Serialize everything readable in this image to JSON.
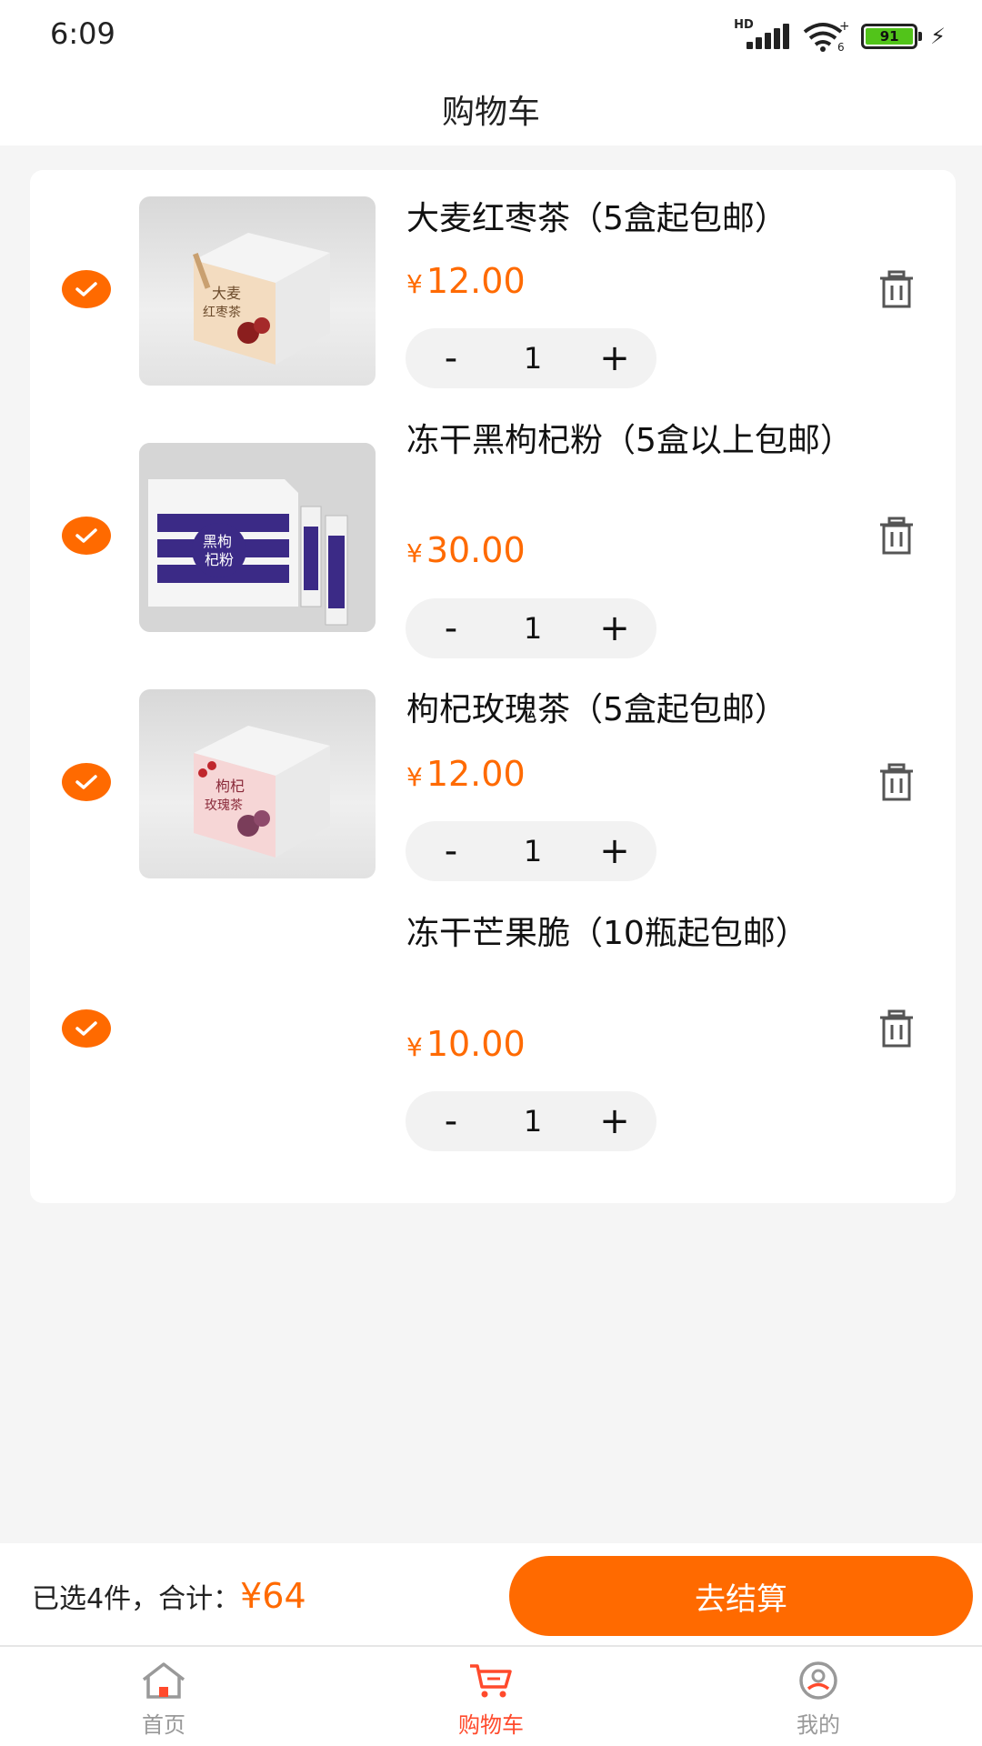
{
  "status_bar": {
    "time": "6:09",
    "battery": "91"
  },
  "header": {
    "title": "购物车"
  },
  "cart": {
    "currency": "¥",
    "items": [
      {
        "name": "大麦红枣茶（5盒起包邮）",
        "price": "12.00",
        "quantity": "1",
        "checked": true,
        "minus": "-",
        "plus": "+"
      },
      {
        "name": "冻干黑枸杞粉（5盒以上包邮）",
        "price": "30.00",
        "quantity": "1",
        "checked": true,
        "minus": "-",
        "plus": "+"
      },
      {
        "name": "枸杞玫瑰茶（5盒起包邮）",
        "price": "12.00",
        "quantity": "1",
        "checked": true,
        "minus": "-",
        "plus": "+"
      },
      {
        "name": "冻干芒果脆（10瓶起包邮）",
        "price": "10.00",
        "quantity": "1",
        "checked": true,
        "minus": "-",
        "plus": "+"
      }
    ]
  },
  "checkout": {
    "summary_label": "已选4件，合计：",
    "total": "¥64",
    "button_label": "去结算"
  },
  "tabbar": {
    "tabs": [
      {
        "label": "首页",
        "icon": "home-icon",
        "active": false
      },
      {
        "label": "购物车",
        "icon": "cart-icon",
        "active": true
      },
      {
        "label": "我的",
        "icon": "user-icon",
        "active": false
      }
    ]
  },
  "colors": {
    "accent": "#ff6a00",
    "tab_active": "#ff4a2c",
    "tab_inactive": "#999999"
  }
}
